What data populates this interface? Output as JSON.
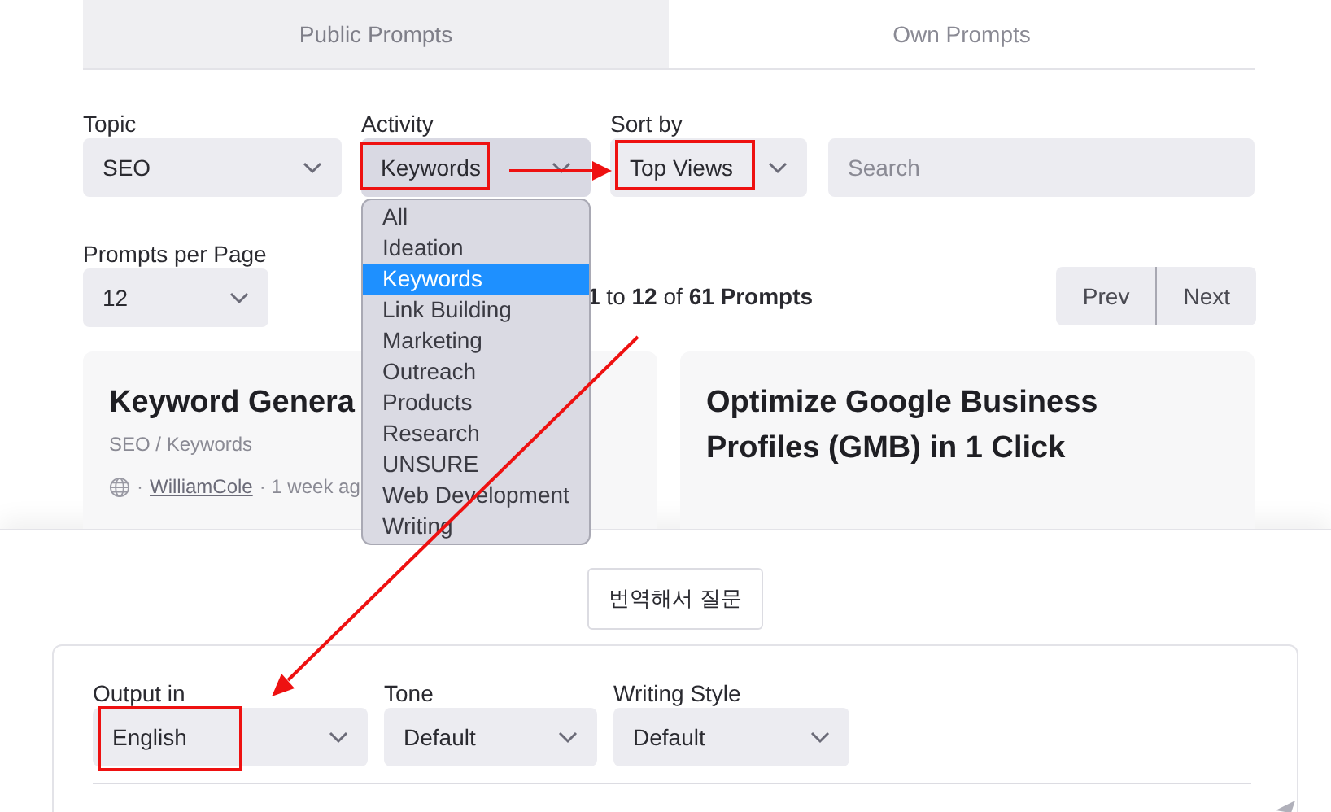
{
  "tabs": [
    {
      "label": "Public Prompts",
      "selected": true
    },
    {
      "label": "Own Prompts",
      "selected": false
    }
  ],
  "filters": [
    {
      "label": "Topic",
      "value": "SEO",
      "open": false
    },
    {
      "label": "Activity",
      "value": "Keywords",
      "open": true
    },
    {
      "label": "Sort by",
      "value": "Top Views",
      "open": false
    }
  ],
  "search": {
    "placeholder": "Search"
  },
  "activity_options": [
    {
      "label": "All",
      "selected": false
    },
    {
      "label": "Ideation",
      "selected": false
    },
    {
      "label": "Keywords",
      "selected": true
    },
    {
      "label": "Link Building",
      "selected": false
    },
    {
      "label": "Marketing",
      "selected": false
    },
    {
      "label": "Outreach",
      "selected": false
    },
    {
      "label": "Products",
      "selected": false
    },
    {
      "label": "Research",
      "selected": false
    },
    {
      "label": "UNSURE",
      "selected": false
    },
    {
      "label": "Web Development",
      "selected": false
    },
    {
      "label": "Writing",
      "selected": false
    }
  ],
  "per_page": {
    "label": "Prompts per Page",
    "value": "12"
  },
  "results_summary": "**1** to **12** of **61 Prompts**",
  "pagination": [
    "Prev",
    "Next"
  ],
  "cards": [
    {
      "title": "Keyword Genera",
      "meta": "SEO / Keywords",
      "separator": "·",
      "author": "WilliamCole",
      "age": "· 1 week ag"
    },
    {
      "title": "Optimize Google Business Profiles (GMB) in 1 Click"
    }
  ],
  "translate_button": "번역해서 질문",
  "output_options": [
    {
      "label": "Output in",
      "value": "English"
    },
    {
      "label": "Tone",
      "value": "Default"
    },
    {
      "label": "Writing Style",
      "value": "Default"
    }
  ]
}
